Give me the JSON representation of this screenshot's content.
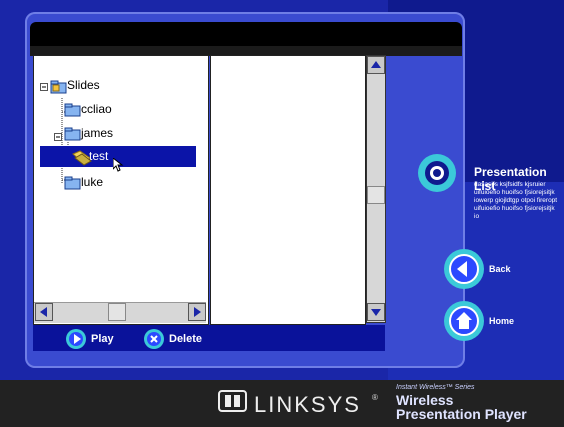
{
  "tree": {
    "root_label": "Slides",
    "items": [
      {
        "label": "ccliao"
      },
      {
        "label": "james"
      },
      {
        "label": "test"
      },
      {
        "label": "luke"
      }
    ]
  },
  "toolbar": {
    "play_label": "Play",
    "delete_label": "Delete"
  },
  "sidebar": {
    "presentation_title": "Presentation List",
    "presentation_desc": "dasasjfs ksjfsidfs kjsruier uifuioefio huoifso fjsiorejsitjk iowerp giojldtgp otpoi fireropt uifuioefio huoifso fjsiorejsitjk io",
    "back_label": "Back",
    "home_label": "Home"
  },
  "footer": {
    "brand": "LINKSYS",
    "registered": "®",
    "series": "Instant Wireless™ Series",
    "product_line1": "Wireless",
    "product_line2": "Presentation Player"
  },
  "colors": {
    "accent": "#1a26a8",
    "selection": "#0b14a8",
    "teal": "#3bc9d9"
  }
}
